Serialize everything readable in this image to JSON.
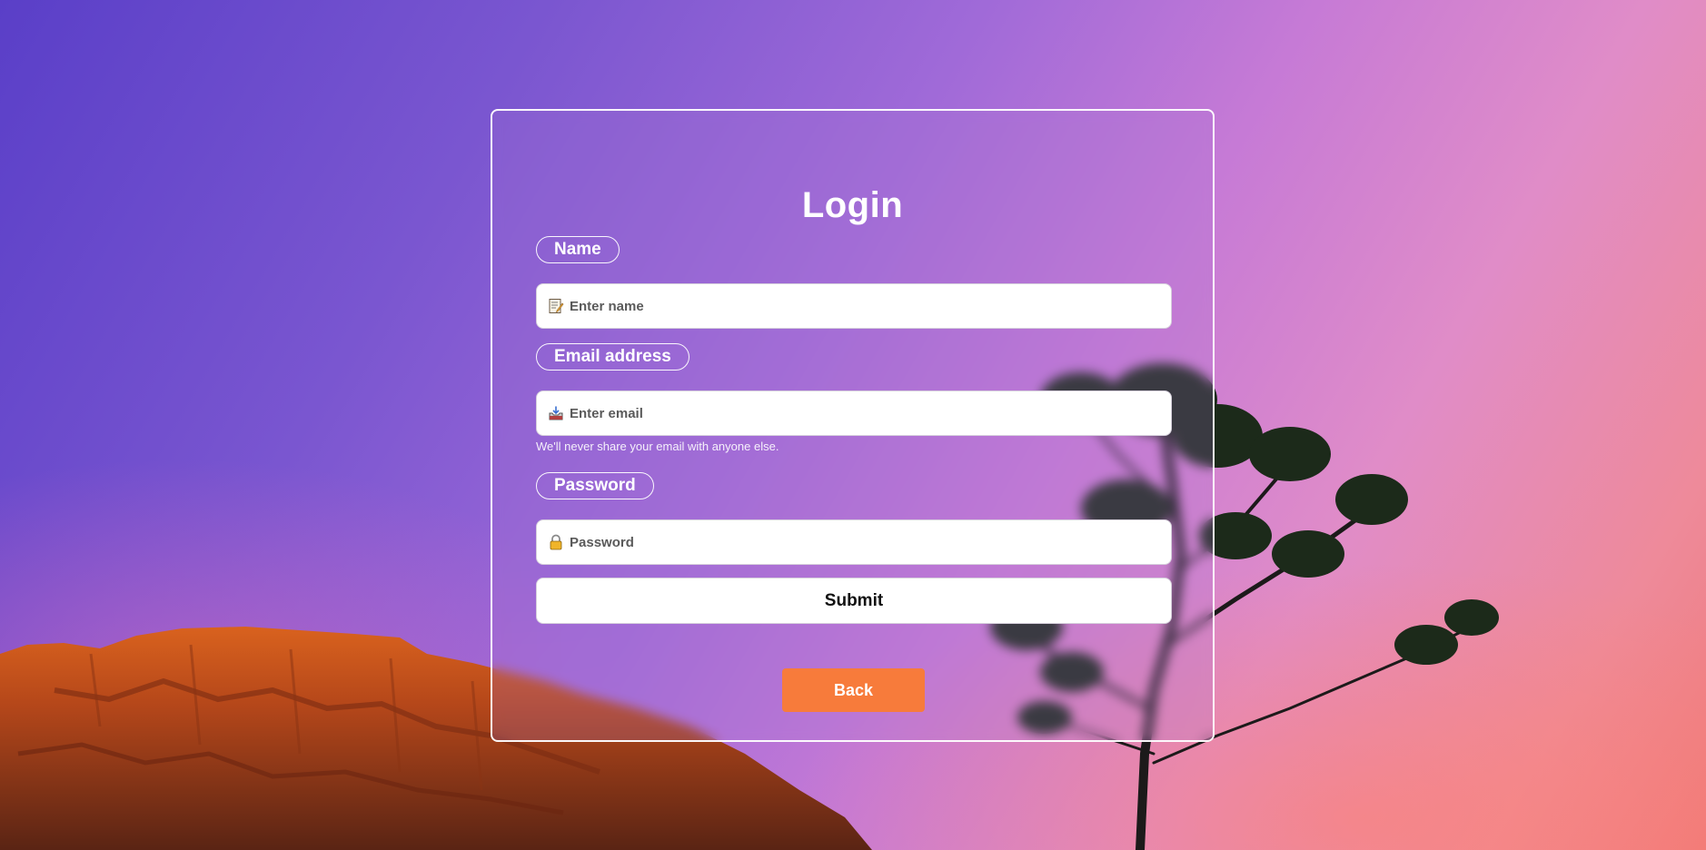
{
  "colors": {
    "accent_back": "#f77b3b",
    "card_border": "#ffffff",
    "text_light": "#ffffff"
  },
  "form": {
    "title": "Login",
    "name": {
      "label": "Name",
      "placeholder": "Enter name",
      "value": "",
      "icon": "memo-icon"
    },
    "email": {
      "label": "Email address",
      "placeholder": "Enter email",
      "value": "",
      "icon": "inbox-tray-icon",
      "helper": "We'll never share your email with anyone else."
    },
    "password": {
      "label": "Password",
      "placeholder": "Password",
      "value": "",
      "icon": "lock-icon"
    },
    "submit_label": "Submit",
    "back_label": "Back"
  }
}
